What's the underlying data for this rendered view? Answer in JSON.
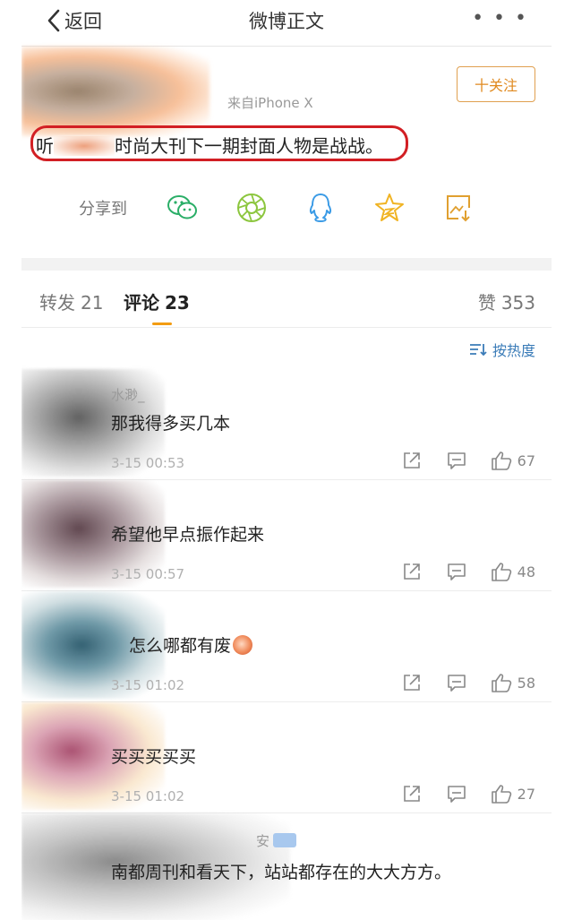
{
  "nav": {
    "back_label": "返回",
    "title": "微博正文",
    "more": "• • •"
  },
  "post": {
    "source": "来自iPhone X",
    "follow_label": "十关注",
    "text_prefix": "听",
    "text_main": "时尚大刊下一期封面人物是战战。",
    "share_label": "分享到",
    "share_icons": [
      "wechat-icon",
      "moments-icon",
      "qq-icon",
      "qzone-icon",
      "save-image-icon"
    ]
  },
  "tabs": {
    "repost_label": "转发",
    "repost_count": "21",
    "comment_label": "评论",
    "comment_count": "23",
    "like_label": "赞",
    "like_count": "353"
  },
  "sort_label": "按热度",
  "comments": [
    {
      "name": "水渺_",
      "text": "那我得多买几本",
      "time": "3-15 00:53",
      "likes": "67"
    },
    {
      "name": "",
      "text": "希望他早点振作起来",
      "time": "3-15 00:57",
      "likes": "48"
    },
    {
      "name": "",
      "text": "怎么哪都有废",
      "time": "3-15 01:02",
      "likes": "58"
    },
    {
      "name": "",
      "text": "买买买买买",
      "time": "3-15 01:02",
      "likes": "27"
    },
    {
      "name": "安",
      "text": "南都周刊和看天下，站站都存在的大大方方。",
      "time": "",
      "likes": ""
    }
  ],
  "colors": {
    "accent": "#e08a20",
    "link": "#3b7cb8",
    "highlight": "#d21f24"
  }
}
